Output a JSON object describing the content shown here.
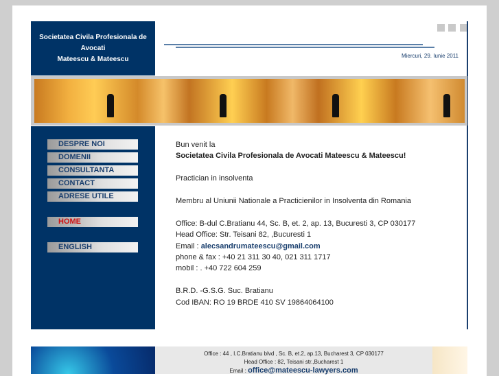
{
  "header": {
    "brand_lines": [
      "Societatea Civila Profesionala de",
      "Avocati",
      "Mateescu & Mateescu"
    ],
    "date": "Miercuri, 29. Iunie 2011"
  },
  "menu": {
    "items": [
      "DESPRE NOI",
      "DOMENII",
      "CONSULTANTA",
      "CONTACT",
      "ADRESE UTILE"
    ],
    "home": "HOME",
    "english": "ENGLISH"
  },
  "content": {
    "welcome": "Bun venit la",
    "company": "Societatea Civila Profesionala de Avocati Mateescu & Mateescu!",
    "role": "Practician in insolventa",
    "member": "Membru al Uniunii Nationale a Practicienilor in Insolventa din Romania",
    "office": "Office: B-dul C.Bratianu 44, Sc. B, et. 2, ap. 13, Bucuresti 3, CP 030177",
    "head_office": "Head Office: Str. Teisani 82, ,Bucuresti 1",
    "email_label": "Email : ",
    "email": "alecsandrumateescu@gmail.com",
    "phone": "phone & fax : +40 21 311 30 40, 021 311 1717",
    "mobile": "mobil : . +40 722 604 259",
    "bank": "B.R.D. -G.S.G. Suc. Bratianu",
    "iban": "Cod IBAN: RO 19 BRDE 410 SV 19864064100"
  },
  "footer": {
    "office": "Office : 44 , I.C.Bratianu blvd , Sc. B, et.2, ap.13, Bucharest 3, CP 030177",
    "head_office": "Head Office : 82, Teisani str.,Bucharest 1",
    "email_label": "Email : ",
    "email": "office@mateescu-lawyers.com"
  },
  "colors": {
    "navy": "#003366",
    "home_red": "#d01010"
  }
}
